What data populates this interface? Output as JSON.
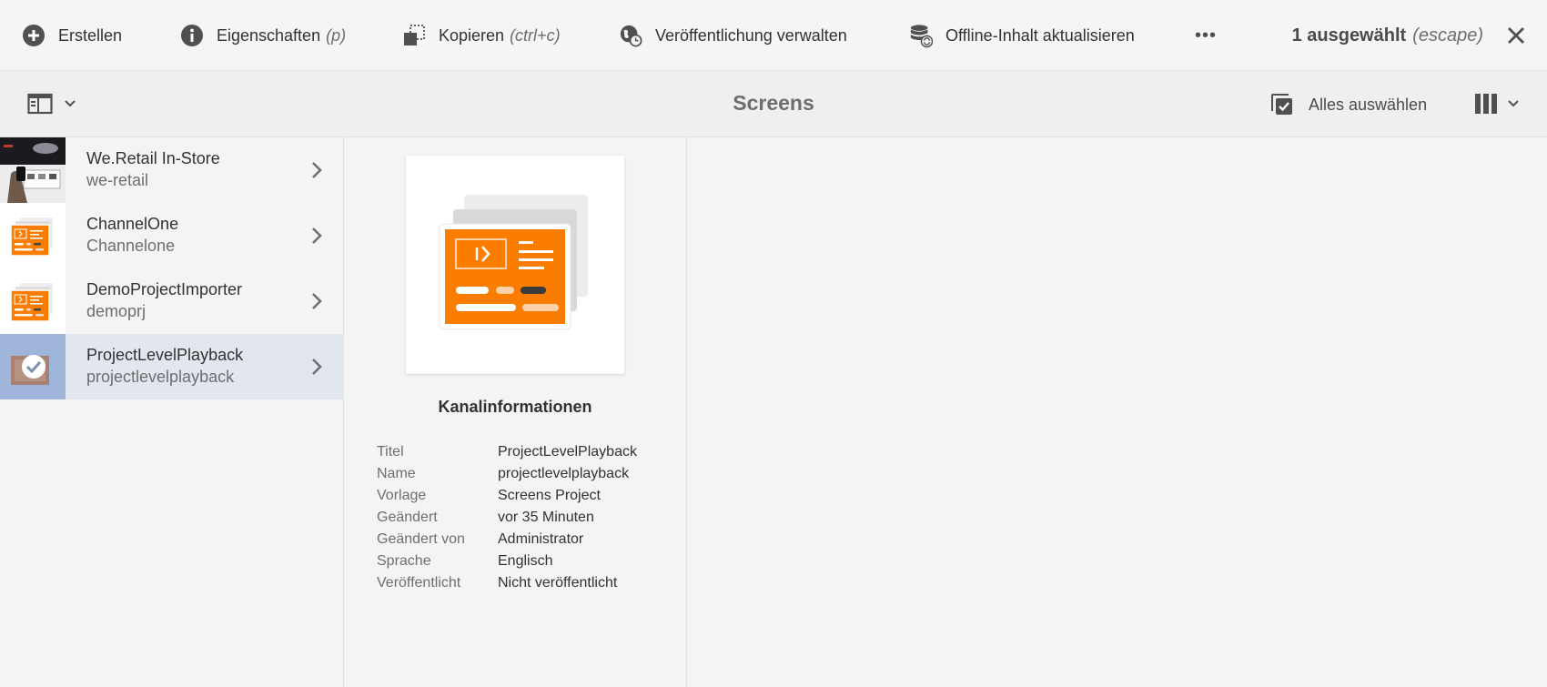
{
  "actionbar": {
    "create": {
      "label": "Erstellen",
      "icon": "add-circle-icon"
    },
    "properties": {
      "label": "Eigenschaften",
      "hint": "(p)",
      "icon": "info-icon"
    },
    "copy": {
      "label": "Kopieren",
      "hint": "(ctrl+c)",
      "icon": "copy-icon"
    },
    "publish": {
      "label": "Veröffentlichung verwalten",
      "icon": "globe-clock-icon"
    },
    "offline": {
      "label": "Offline-Inhalt aktualisieren",
      "icon": "database-refresh-icon"
    },
    "more": {
      "label": "•••",
      "icon": "more-icon"
    },
    "selection": {
      "count_label": "1 ausgewählt",
      "hint": "(escape)"
    }
  },
  "titlebar": {
    "title": "Screens",
    "select_all": "Alles auswählen"
  },
  "items": [
    {
      "title": "We.Retail In-Store",
      "name": "we-retail",
      "selected": false,
      "thumb": "photo"
    },
    {
      "title": "ChannelOne",
      "name": "Channelone",
      "selected": false,
      "thumb": "channel"
    },
    {
      "title": "DemoProjectImporter",
      "name": "demoprj",
      "selected": false,
      "thumb": "channel"
    },
    {
      "title": "ProjectLevelPlayback",
      "name": "projectlevelplayback",
      "selected": true,
      "thumb": "check"
    }
  ],
  "details": {
    "heading": "Kanalinformationen",
    "rows": [
      {
        "label": "Titel",
        "value": "ProjectLevelPlayback"
      },
      {
        "label": "Name",
        "value": "projectlevelplayback"
      },
      {
        "label": "Vorlage",
        "value": "Screens Project"
      },
      {
        "label": "Geändert",
        "value": "vor 35 Minuten"
      },
      {
        "label": "Geändert von",
        "value": "Administrator"
      },
      {
        "label": "Sprache",
        "value": "Englisch"
      },
      {
        "label": "Veröffentlicht",
        "value": "Nicht veröffentlicht"
      }
    ]
  },
  "colors": {
    "accent_orange": "#fa7d00",
    "selected_row": "#e1e6ef",
    "selected_thumb": "#9fb5d9"
  }
}
